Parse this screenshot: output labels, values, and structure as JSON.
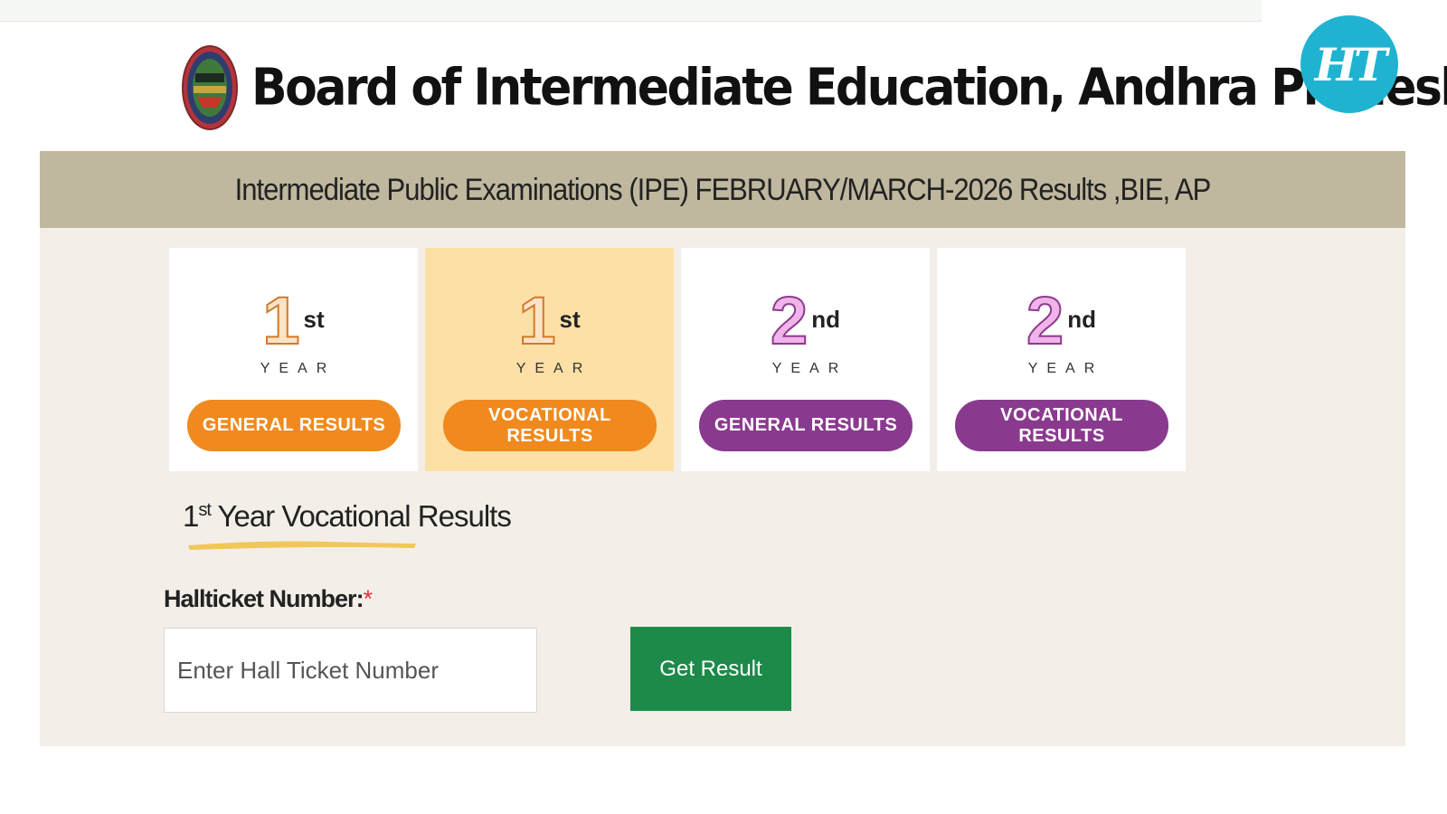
{
  "header": {
    "title": "Board of Intermediate Education, Andhra Pradesh",
    "logo_text": "HT"
  },
  "banner": {
    "text": "Intermediate Public Examinations (IPE) FEBRUARY/MARCH-2026 Results ,BIE, AP"
  },
  "cards": [
    {
      "num": "1",
      "suffix": "st",
      "year_label": "YEAR",
      "button": "GENERAL RESULTS",
      "color": "#f08a1e",
      "active": false
    },
    {
      "num": "1",
      "suffix": "st",
      "year_label": "YEAR",
      "button": "VOCATIONAL RESULTS",
      "color": "#f08a1e",
      "active": true
    },
    {
      "num": "2",
      "suffix": "nd",
      "year_label": "YEAR",
      "button": "GENERAL RESULTS",
      "color": "#8a3a8e",
      "active": false
    },
    {
      "num": "2",
      "suffix": "nd",
      "year_label": "YEAR",
      "button": "VOCATIONAL RESULTS",
      "color": "#8a3a8e",
      "active": false
    }
  ],
  "section": {
    "num": "1",
    "suffix": "st",
    "title": " Year Vocational Results"
  },
  "form": {
    "label": "Hallticket Number:",
    "required_mark": "*",
    "placeholder": "Enter Hall Ticket Number",
    "value": "",
    "submit_label": "Get Result"
  },
  "colors": {
    "banner_bg": "#bfb79e",
    "panel_bg": "#f3efe8",
    "active_card_bg": "#fde0a6",
    "submit_bg": "#1d8a4a",
    "ht_logo_bg": "#1fb3d1"
  },
  "icons": {
    "emblem": "state-emblem-icon",
    "underline": "highlight-stroke"
  }
}
